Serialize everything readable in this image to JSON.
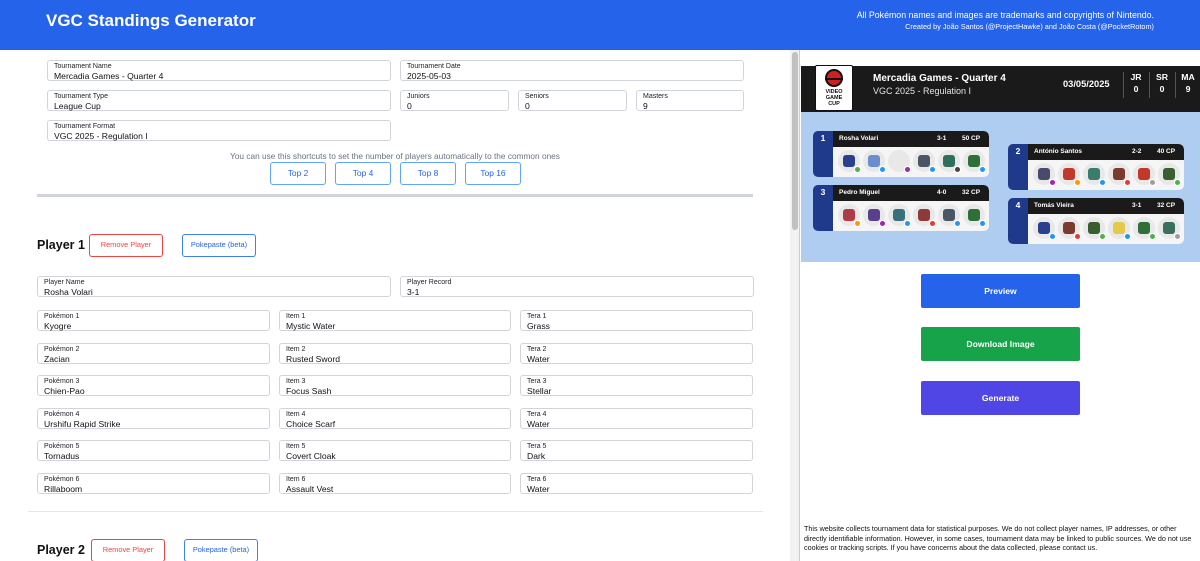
{
  "header": {
    "title": "VGC Standings Generator",
    "disclaimer": "All Pokémon names and images are trademarks and copyrights of Nintendo.",
    "credits": "Created by João Santos (@ProjectHawke) and João Costa (@PocketRotom)"
  },
  "tournament": {
    "name_label": "Tournament Name",
    "name_value": "Mercadia Games - Quarter 4",
    "date_label": "Tournament Date",
    "date_value": "2025-05-03",
    "type_label": "Tournament Type",
    "type_value": "League Cup",
    "juniors_label": "Juniors",
    "juniors_value": "0",
    "seniors_label": "Seniors",
    "seniors_value": "0",
    "masters_label": "Masters",
    "masters_value": "9",
    "format_label": "Tournament Format",
    "format_value": "VGC 2025 - Regulation I"
  },
  "shortcuts": {
    "hint": "You can use this shortcuts to set the number of players automatically to the common ones",
    "buttons": [
      "Top 2",
      "Top 4",
      "Top 8",
      "Top 16"
    ]
  },
  "player1": {
    "title": "Player 1",
    "remove_label": "Remove Player",
    "pokepaste_label": "Pokepaste (beta)",
    "name_label": "Player Name",
    "name_value": "Rosha Volari",
    "record_label": "Player Record",
    "record_value": "3-1",
    "team": [
      {
        "pokemon_label": "Pokémon 1",
        "pokemon": "Kyogre",
        "item_label": "Item 1",
        "item": "Mystic Water",
        "tera_label": "Tera 1",
        "tera": "Grass"
      },
      {
        "pokemon_label": "Pokémon 2",
        "pokemon": "Zacian",
        "item_label": "Item 2",
        "item": "Rusted Sword",
        "tera_label": "Tera 2",
        "tera": "Water"
      },
      {
        "pokemon_label": "Pokémon 3",
        "pokemon": "Chien-Pao",
        "item_label": "Item 3",
        "item": "Focus Sash",
        "tera_label": "Tera 3",
        "tera": "Stellar"
      },
      {
        "pokemon_label": "Pokémon 4",
        "pokemon": "Urshifu Rapid Strike",
        "item_label": "Item 4",
        "item": "Choice Scarf",
        "tera_label": "Tera 4",
        "tera": "Water"
      },
      {
        "pokemon_label": "Pokémon 5",
        "pokemon": "Tornadus",
        "item_label": "Item 5",
        "item": "Covert Cloak",
        "tera_label": "Tera 5",
        "tera": "Dark"
      },
      {
        "pokemon_label": "Pokémon 6",
        "pokemon": "Rillaboom",
        "item_label": "Item 6",
        "item": "Assault Vest",
        "tera_label": "Tera 6",
        "tera": "Water"
      }
    ]
  },
  "player2": {
    "title": "Player 2",
    "remove_label": "Remove Player",
    "pokepaste_label": "Pokepaste (beta)"
  },
  "preview": {
    "logo_text": [
      "VIDEO",
      "GAME",
      "CUP"
    ],
    "tournament_name": "Mercadia Games - Quarter 4",
    "format": "VGC 2025 - Regulation I",
    "date": "03/05/2025",
    "categories": [
      {
        "label": "JR",
        "count": "0"
      },
      {
        "label": "SR",
        "count": "0"
      },
      {
        "label": "MA",
        "count": "9"
      }
    ],
    "standings": [
      {
        "rank": "1",
        "name": "Rosha Volari",
        "record": "3-1",
        "cp": "50 CP",
        "team_colors": [
          "#2b3f8f",
          "#6b8ecf",
          "#e8e8e8",
          "#4b5563",
          "#2f6f5e",
          "#2f6f3a"
        ],
        "tera_colors": [
          "#4caf50",
          "#2196f3",
          "#9c27b0",
          "#2196f3",
          "#444444",
          "#2196f3"
        ]
      },
      {
        "rank": "2",
        "name": "António Santos",
        "record": "2-2",
        "cp": "40 CP",
        "team_colors": [
          "#4a4a6a",
          "#c0392b",
          "#3a7c6e",
          "#7a3b2e",
          "#c0392b",
          "#3a5f2e"
        ],
        "tera_colors": [
          "#9c27b0",
          "#ff9800",
          "#2196f3",
          "#e53935",
          "#9e9e9e",
          "#4caf50"
        ]
      },
      {
        "rank": "3",
        "name": "Pedro Miguel",
        "record": "4-0",
        "cp": "32 CP",
        "team_colors": [
          "#b03a48",
          "#5b3f8f",
          "#3a6f7c",
          "#8f3a3a",
          "#4b5563",
          "#2f6f3a"
        ],
        "tera_colors": [
          "#ff9800",
          "#9c27b0",
          "#2196f3",
          "#e53935",
          "#2196f3",
          "#2196f3"
        ]
      },
      {
        "rank": "4",
        "name": "Tomás Vieira",
        "record": "3-1",
        "cp": "32 CP",
        "team_colors": [
          "#2b3f8f",
          "#7a3b2e",
          "#3a5f2e",
          "#e6c84a",
          "#2f6f3a",
          "#3a6f5e"
        ],
        "tera_colors": [
          "#2196f3",
          "#e53935",
          "#4caf50",
          "#2196f3",
          "#4caf50",
          "#9e9e9e"
        ]
      }
    ]
  },
  "actions": {
    "preview": "Preview",
    "download": "Download Image",
    "generate": "Generate",
    "preview_color": "#2563eb",
    "download_color": "#16a34a",
    "generate_color": "#4f46e5"
  },
  "privacy": "This website collects tournament data for statistical purposes. We do not collect player names, IP addresses, or other directly identifiable information. However, in some cases, tournament data may be linked to public sources. We do not use cookies or tracking scripts. If you have concerns about the data collected, please contact us."
}
